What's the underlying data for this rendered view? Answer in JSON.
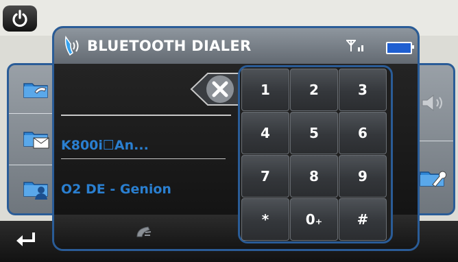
{
  "window": {
    "title": "BLUETOOTH DIALER"
  },
  "status": {
    "signal_icon": "signal-icon",
    "battery_icon": "battery-icon",
    "battery_color": "#1f5fd1"
  },
  "dialer": {
    "number_field_value": "",
    "contacts": [
      {
        "label": "K800i☐An..."
      },
      {
        "label": "O2 DE - Genion"
      }
    ]
  },
  "keypad": {
    "keys": [
      {
        "label": "1"
      },
      {
        "label": "2"
      },
      {
        "label": "3"
      },
      {
        "label": "4"
      },
      {
        "label": "5"
      },
      {
        "label": "6"
      },
      {
        "label": "7"
      },
      {
        "label": "8"
      },
      {
        "label": "9"
      },
      {
        "label": "*"
      },
      {
        "label": "0₊"
      },
      {
        "label": "#"
      }
    ]
  },
  "colors": {
    "accent_blue": "#2a5c97",
    "contact_text": "#2a7fd0"
  }
}
